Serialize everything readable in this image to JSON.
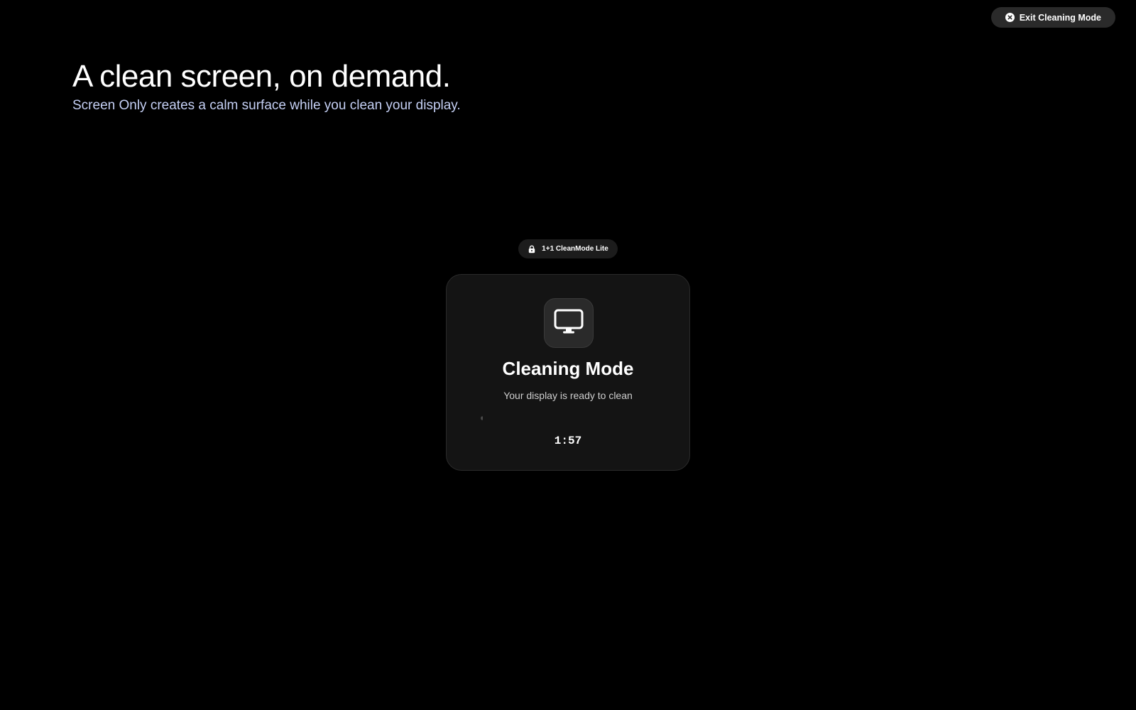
{
  "header": {
    "exit_label": "Exit Cleaning Mode",
    "exit_icon": "close-circle-icon"
  },
  "hero": {
    "title": "A clean screen, on demand.",
    "subtitle": "Screen Only creates a calm surface while you clean your display."
  },
  "badge": {
    "label": "1+1 CleanMode Lite",
    "icon": "lock-icon"
  },
  "card": {
    "icon": "monitor-icon",
    "title": "Cleaning Mode",
    "subtitle": "Your display is ready to clean",
    "progress": 0.01,
    "timer": "1:57"
  },
  "colors": {
    "background": "#000000",
    "card": "#141414",
    "subtitle_accent": "#c5d0f5"
  }
}
